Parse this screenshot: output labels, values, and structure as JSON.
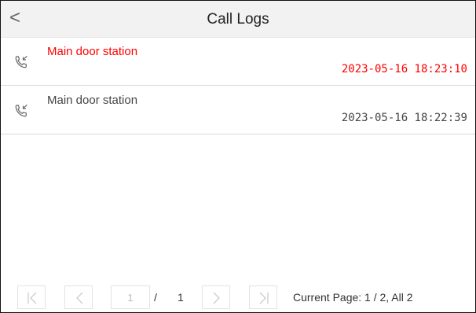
{
  "header": {
    "title": "Call Logs",
    "back_label": "<"
  },
  "logs": [
    {
      "caller": "Main door station",
      "time": "2023-05-16 18:23:10",
      "status": "missed",
      "icon": "phone-incoming-icon",
      "color": "#ff0000"
    },
    {
      "caller": "Main door station",
      "time": "2023-05-16 18:22:39",
      "status": "answered",
      "icon": "phone-incoming-icon",
      "color": "#444444"
    }
  ],
  "pagination": {
    "page_input_value": "1",
    "separator": "/",
    "total_pages": "1",
    "status_text": "Current Page: 1 / 2, All 2",
    "buttons": [
      "first-page-icon",
      "prev-page-icon",
      "next-page-icon",
      "last-page-icon"
    ]
  }
}
